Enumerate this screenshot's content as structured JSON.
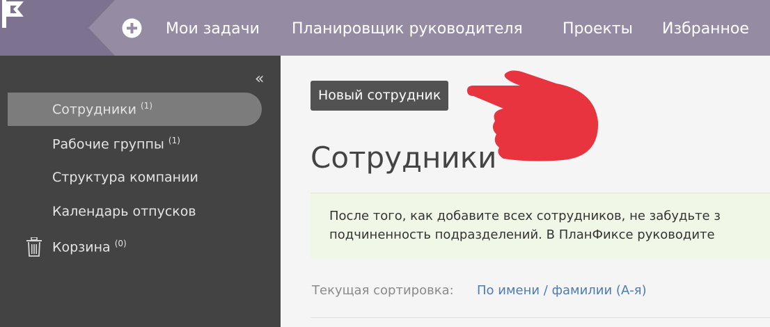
{
  "colors": {
    "topbar": "#958ca4",
    "logo_block": "#7d7290",
    "sidebar": "#434343",
    "sidebar_active": "#7c7c7c",
    "accent_link": "#4d7bb3",
    "pointer_hand": "#e8343e",
    "notice_bg": "#f1f7e6"
  },
  "header": {
    "logo_icon": "flag-icon",
    "add_icon": "plus-circle-icon",
    "nav": [
      {
        "label": "Мои задачи"
      },
      {
        "label": "Планировщик руководителя"
      },
      {
        "label": "Проекты"
      },
      {
        "label": "Избранное"
      }
    ]
  },
  "sidebar": {
    "collapse_label": "«",
    "items": [
      {
        "label": "Сотрудники",
        "count": "(1)",
        "active": true
      },
      {
        "label": "Рабочие группы",
        "count": "(1)"
      },
      {
        "label": "Структура компании",
        "count": ""
      },
      {
        "label": "Календарь отпусков",
        "count": ""
      },
      {
        "label": "Корзина",
        "count": "(0)",
        "icon": "trash-icon"
      }
    ]
  },
  "main": {
    "new_button_label": "Новый сотрудник",
    "pointer_icon": "pointing-hand-icon",
    "title": "Сотрудники",
    "notice_lines": [
      "После того, как добавите всех сотрудников, не забудьте з",
      "подчиненность подразделений. В ПланФиксе руководите"
    ],
    "sort_label": "Текущая сортировка:",
    "sort_value": "По имени / фамилии (А-я)"
  }
}
